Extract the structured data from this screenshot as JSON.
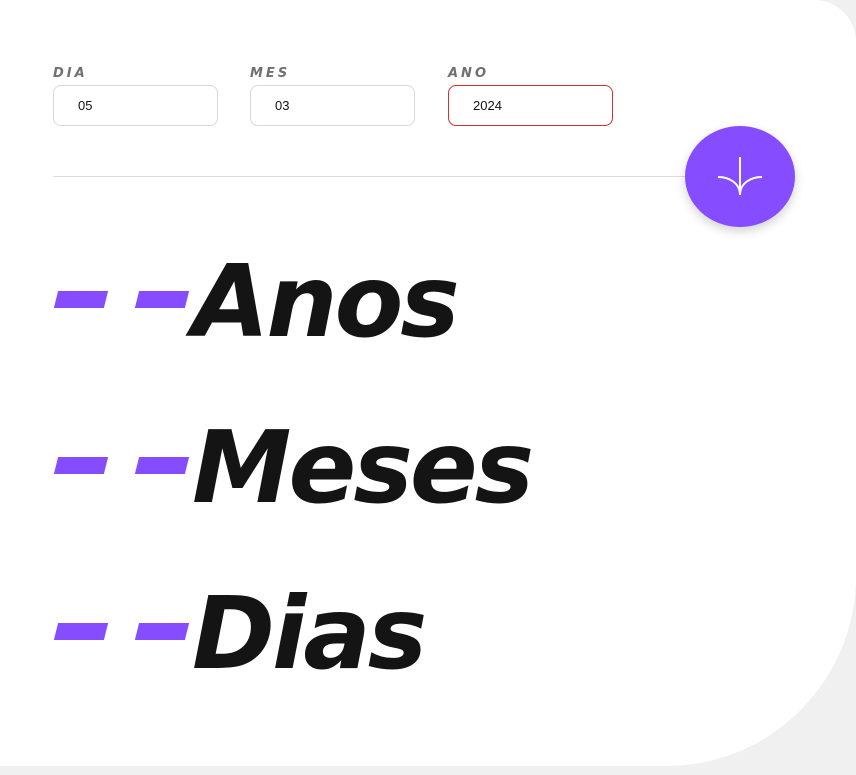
{
  "form": {
    "day": {
      "label": "DIA",
      "value": "05"
    },
    "month": {
      "label": "MES",
      "value": "03"
    },
    "year": {
      "label": "ANO",
      "value": "2024",
      "state": "error"
    }
  },
  "submit_button": {
    "icon": "arrow-down-icon",
    "color": "#854dff"
  },
  "results": {
    "years": {
      "value": "- -",
      "label": "Anos"
    },
    "months": {
      "value": "- -",
      "label": "Meses"
    },
    "days": {
      "value": "- -",
      "label": "Dias"
    }
  },
  "colors": {
    "accent": "#854dff",
    "error": "#d32f2f",
    "text_dark": "#141414",
    "label_gray": "#716f6f"
  }
}
